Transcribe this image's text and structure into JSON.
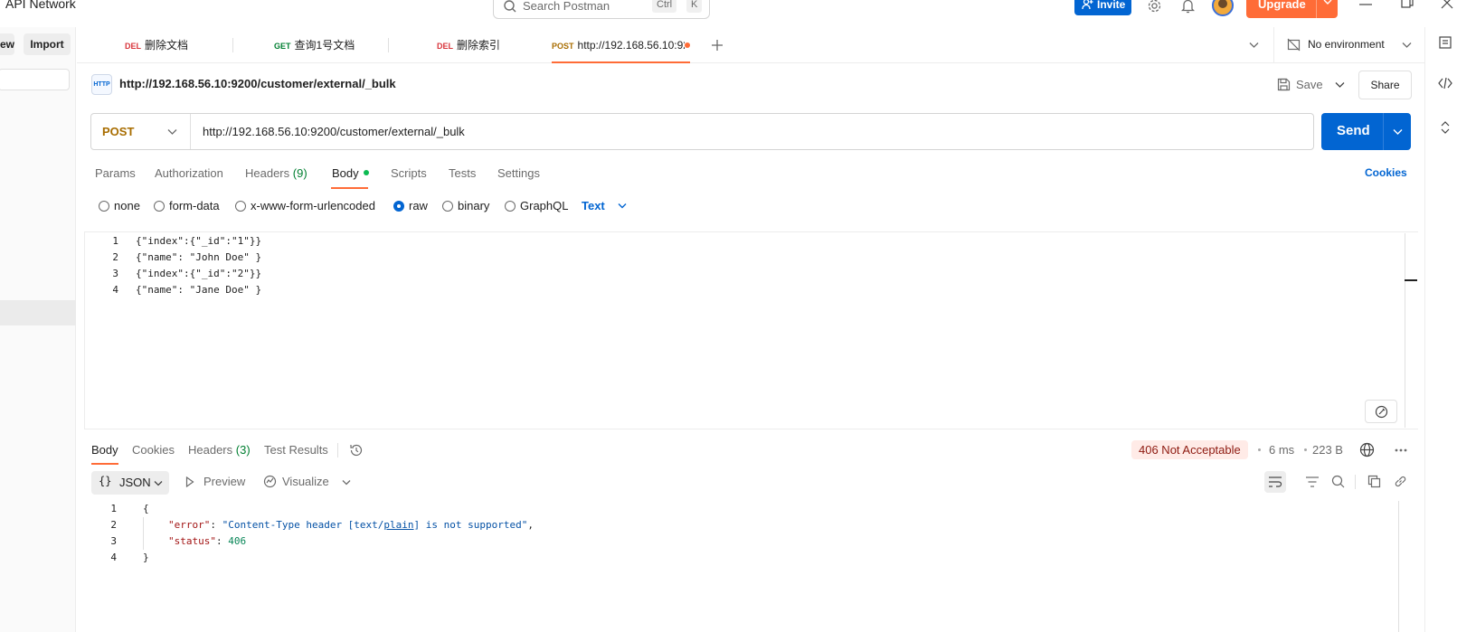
{
  "app": {
    "title": "API Network",
    "search_placeholder": "Search Postman",
    "search_key_1": "Ctrl",
    "search_key_2": "K",
    "invite_label": "Invite",
    "upgrade_label": "Upgrade"
  },
  "sidebar": {
    "new_label": "ew",
    "import_label": "Import"
  },
  "tabs": [
    {
      "method": "DEL",
      "name": "删除文档",
      "method_color": "#d8353b"
    },
    {
      "method": "GET",
      "name": "查询1号文档",
      "method_color": "#007f31"
    },
    {
      "method": "DEL",
      "name": "删除索引",
      "method_color": "#d8353b"
    },
    {
      "method": "POST",
      "name": "http://192.168.56.10:92",
      "method_color": "#a86d00"
    }
  ],
  "environment": {
    "label": "No environment"
  },
  "request": {
    "icon_text": "HTTP",
    "title": "http://192.168.56.10:9200/customer/external/_bulk",
    "save_label": "Save",
    "share_label": "Share",
    "method": "POST",
    "url": "http://192.168.56.10:9200/customer/external/_bulk",
    "send_label": "Send",
    "subtabs": [
      "Params",
      "Authorization",
      "Headers",
      "Body",
      "Scripts",
      "Tests",
      "Settings"
    ],
    "headers_count": "(9)",
    "cookies_label": "Cookies",
    "body_types": [
      "none",
      "form-data",
      "x-www-form-urlencoded",
      "raw",
      "binary",
      "GraphQL"
    ],
    "selected_body_type": "raw",
    "raw_format": "Text",
    "body_lines": [
      {
        "n": "1",
        "text": "{\"index\":{\"_id\":\"1\"}}"
      },
      {
        "n": "2",
        "text": "{\"name\": \"John Doe\" }"
      },
      {
        "n": "3",
        "text": "{\"index\":{\"_id\":\"2\"}}"
      },
      {
        "n": "4",
        "text": "{\"name\": \"Jane Doe\" }"
      }
    ]
  },
  "response": {
    "tabs": [
      "Body",
      "Cookies",
      "Headers",
      "Test Results"
    ],
    "headers_count": "(3)",
    "status": "406 Not Acceptable",
    "time": "6 ms",
    "size": "223 B",
    "format": "JSON",
    "preview_label": "Preview",
    "visualize_label": "Visualize",
    "lines": {
      "n1": "1",
      "l1": "{",
      "n2": "2",
      "k2": "\"error\"",
      "sep2": ": ",
      "v2a": "\"Content-Type header [text/",
      "v2b": "plain",
      "v2c": "] is not supported\"",
      "t2": ",",
      "n3": "3",
      "k3": "\"status\"",
      "sep3": ": ",
      "v3": "406",
      "n4": "4",
      "l4": "}"
    }
  },
  "colors": {
    "accent": "#ff6c37",
    "primary": "#0265d2",
    "post_method": "#a86d00",
    "status_error_bg": "#ffebe7",
    "status_error_fg": "#8e1a10"
  }
}
